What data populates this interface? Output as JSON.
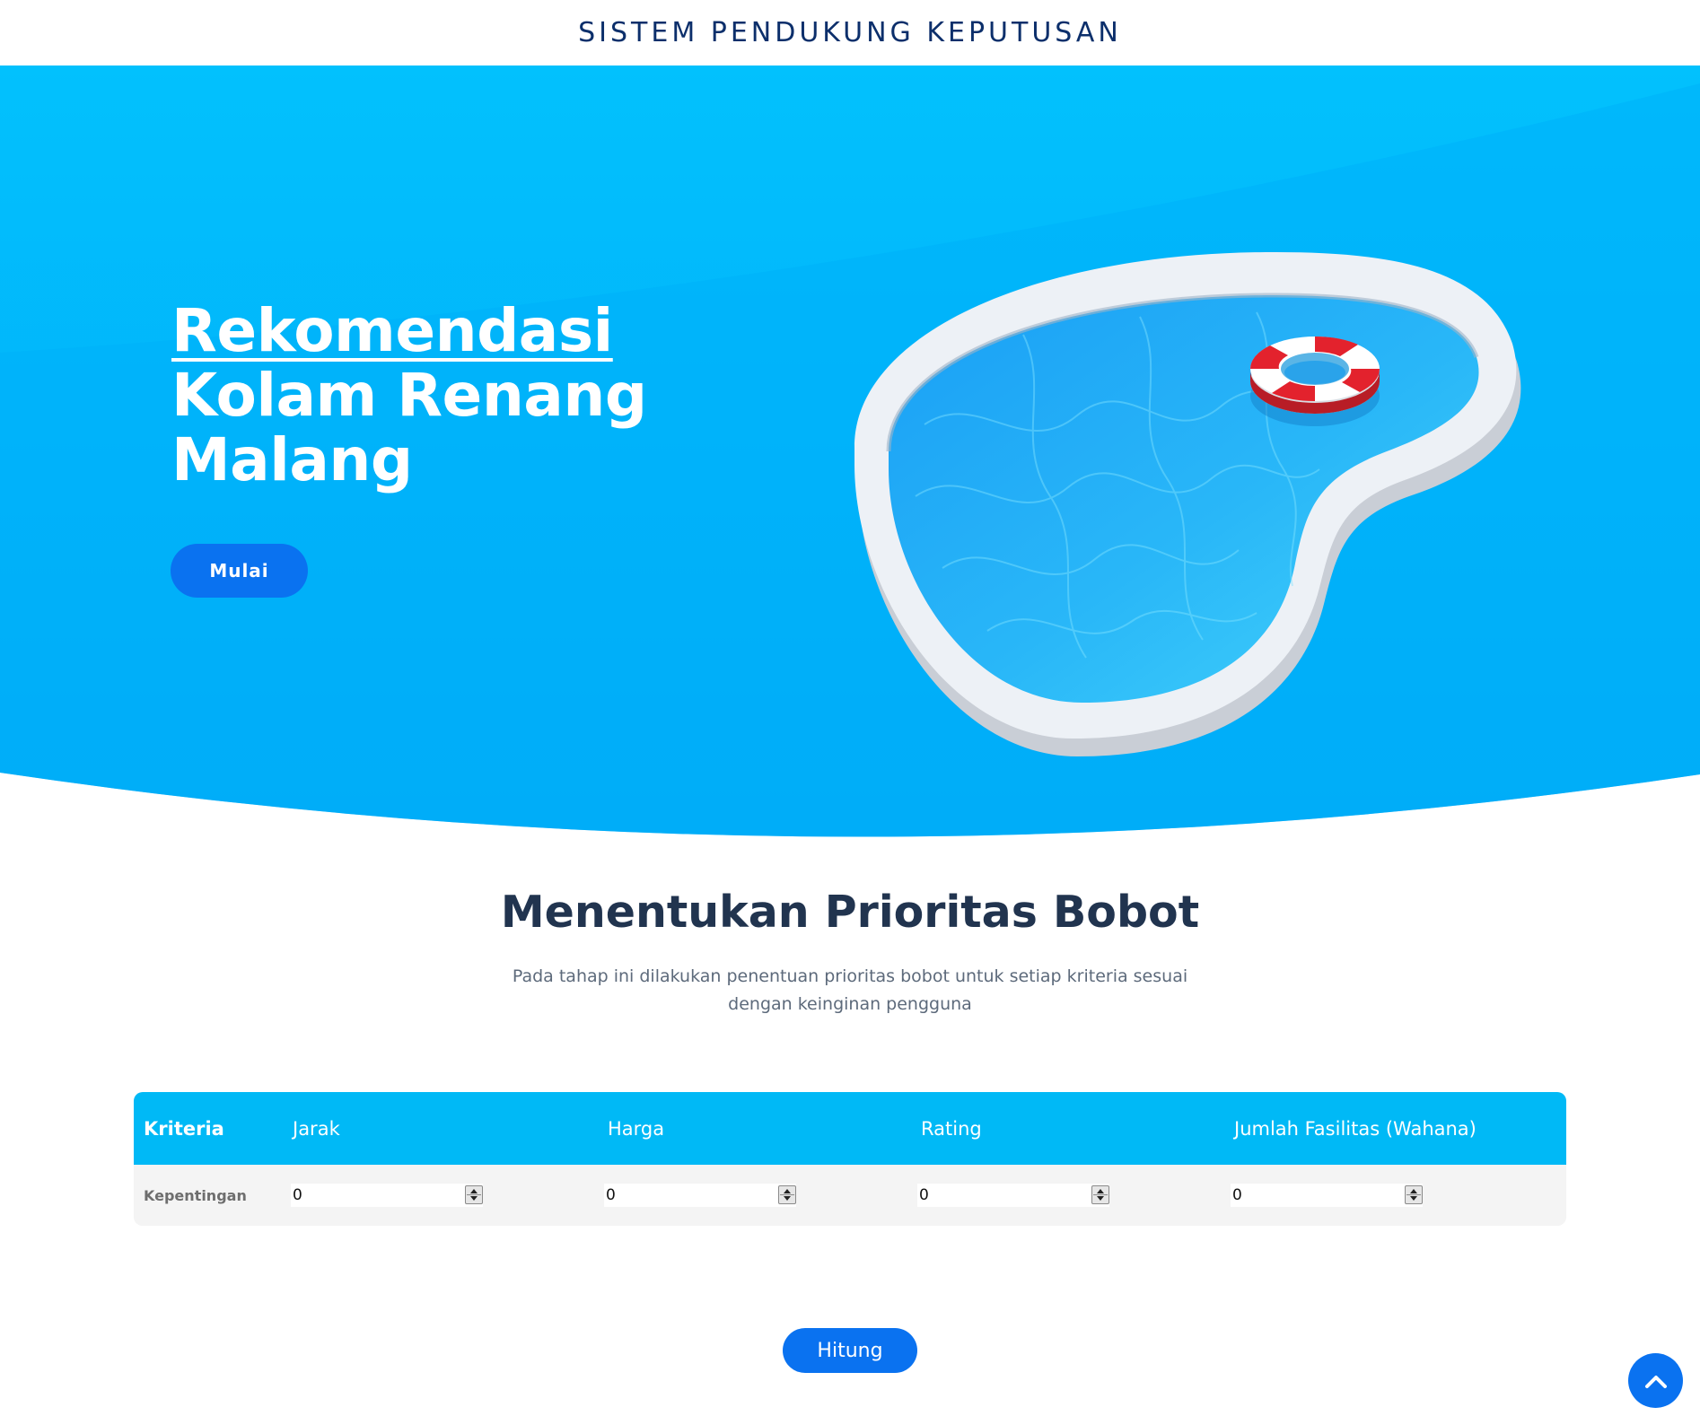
{
  "header": {
    "brand": "SISTEM PENDUKUNG KEPUTUSAN"
  },
  "hero": {
    "title_line1": "Rekomendasi",
    "title_line2": "Kolam Renang",
    "title_line3": "Malang",
    "start_button": "Mulai",
    "illustration": "swimming-pool-with-lifebuoy"
  },
  "section": {
    "title": "Menentukan Prioritas Bobot",
    "description": "Pada tahap ini dilakukan penentuan prioritas bobot untuk setiap kriteria sesuai dengan keinginan pengguna"
  },
  "table": {
    "header_label": "Kriteria",
    "columns": [
      "Jarak",
      "Harga",
      "Rating",
      "Jumlah Fasilitas (Wahana)"
    ],
    "row_label": "Kepentingan",
    "values": [
      "0",
      "0",
      "0",
      "0"
    ]
  },
  "actions": {
    "calculate_button": "Hitung",
    "scroll_top_icon": "chevron-up-icon"
  },
  "colors": {
    "brand_text": "#0c2f6b",
    "hero_bg": "#03b4fb",
    "primary_button": "#0a72f0",
    "table_header": "#00b9f6",
    "table_row": "#f4f4f4"
  }
}
